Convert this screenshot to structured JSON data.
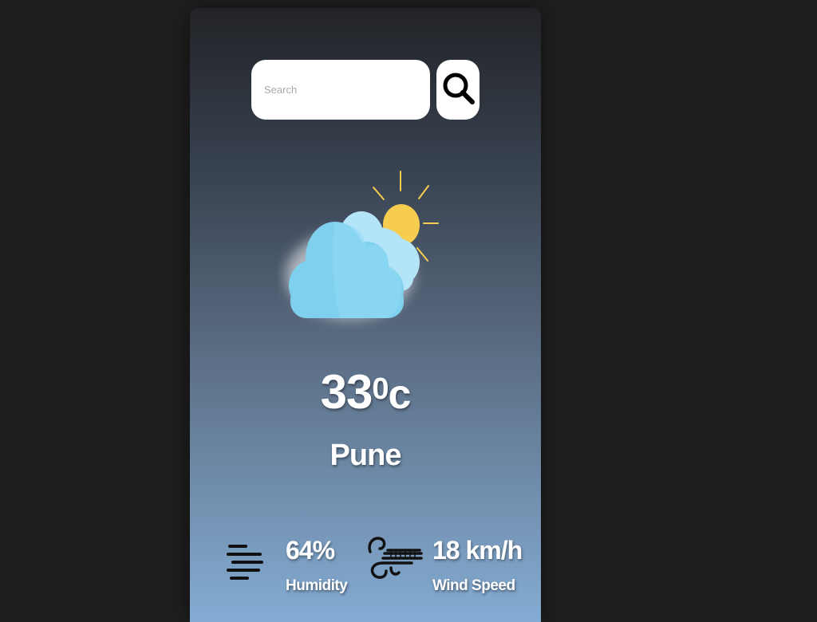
{
  "search": {
    "placeholder": "Search",
    "value": ""
  },
  "weather": {
    "icon": "partly-cloudy-icon",
    "temperature": "33",
    "degree": "0",
    "unit": "c",
    "city": "Pune"
  },
  "stats": {
    "humidity": {
      "icon": "humidity-lines-icon",
      "value": "64%",
      "label": "Humidity"
    },
    "wind": {
      "icon": "wind-icon",
      "value": "18 km/h",
      "label": "Wind Speed"
    }
  },
  "colors": {
    "page_background": "#1f1f1f",
    "card_top": "#222327",
    "card_bottom": "#84acd3",
    "cloud_front": "#7fd0ee",
    "cloud_back": "#b4e4f7",
    "sun": "#f7cd4f"
  }
}
